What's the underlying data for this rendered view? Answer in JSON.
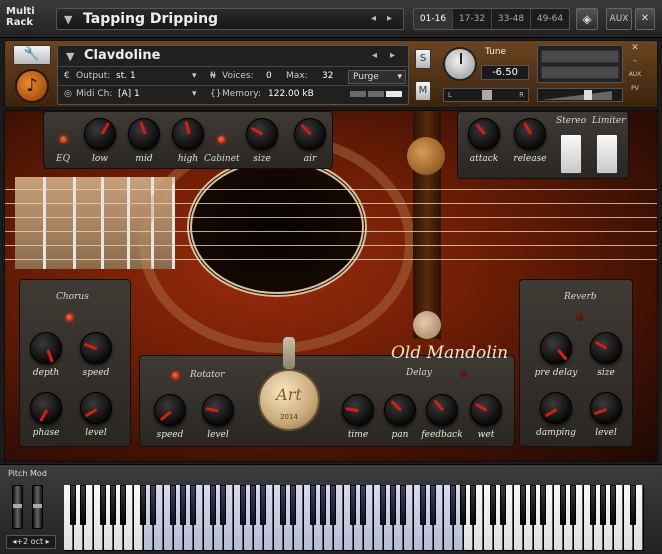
{
  "rack": {
    "label": "Multi Rack",
    "title": "Tapping Dripping",
    "tabs": [
      "01-16",
      "17-32",
      "33-48",
      "49-64"
    ],
    "active_tab": 0,
    "aux_label": "AUX",
    "close_label": "✕"
  },
  "instrument": {
    "name": "Clavdoline",
    "output_label": "Output:",
    "output_value": "st. 1",
    "midi_label": "Midi Ch:",
    "midi_value": "[A]  1",
    "voices_label": "Voices:",
    "voices_value": "0",
    "max_label": "Max:",
    "max_value": "32",
    "purge_label": "Purge",
    "memory_label": "Memory:",
    "memory_value": "122.00 kB",
    "solo_label": "S",
    "mute_label": "M",
    "tune_label": "Tune",
    "tune_value": "-6.50",
    "pan_left": "L",
    "pan_right": "R",
    "aux_side": "AUX",
    "pv_side": "PV"
  },
  "panels": {
    "top": {
      "eq": "EQ",
      "low": "low",
      "mid": "mid",
      "high": "high",
      "cabinet": "Cabinet",
      "size": "size",
      "air": "air"
    },
    "comp": {
      "attack": "attack",
      "release": "release",
      "stereo": "Stereo",
      "limiter": "Limiter"
    },
    "chorus": {
      "title": "Chorus",
      "depth": "depth",
      "speed": "speed",
      "phase": "phase",
      "level": "level"
    },
    "rotator": {
      "title": "Rotator",
      "speed": "speed",
      "level": "level"
    },
    "delay": {
      "title": "Delay",
      "time": "time",
      "pan": "pan",
      "feedback": "feedback",
      "wet": "wet"
    },
    "reverb": {
      "title": "Reverb",
      "pre_delay": "pre delay",
      "size": "size",
      "damping": "damping",
      "level": "level"
    }
  },
  "branding": {
    "logo": "Old Mandolin",
    "medal_year": "2014",
    "medal_text": "Art"
  },
  "keyboard": {
    "pitch_label": "Pitch Mod",
    "octave_label": "◂+2 oct ▸"
  },
  "colors": {
    "accent_red": "#d81c12",
    "wood_dark": "#3b1004",
    "panel": "#3f3a34",
    "key_highlight": "#c6cbe3"
  }
}
